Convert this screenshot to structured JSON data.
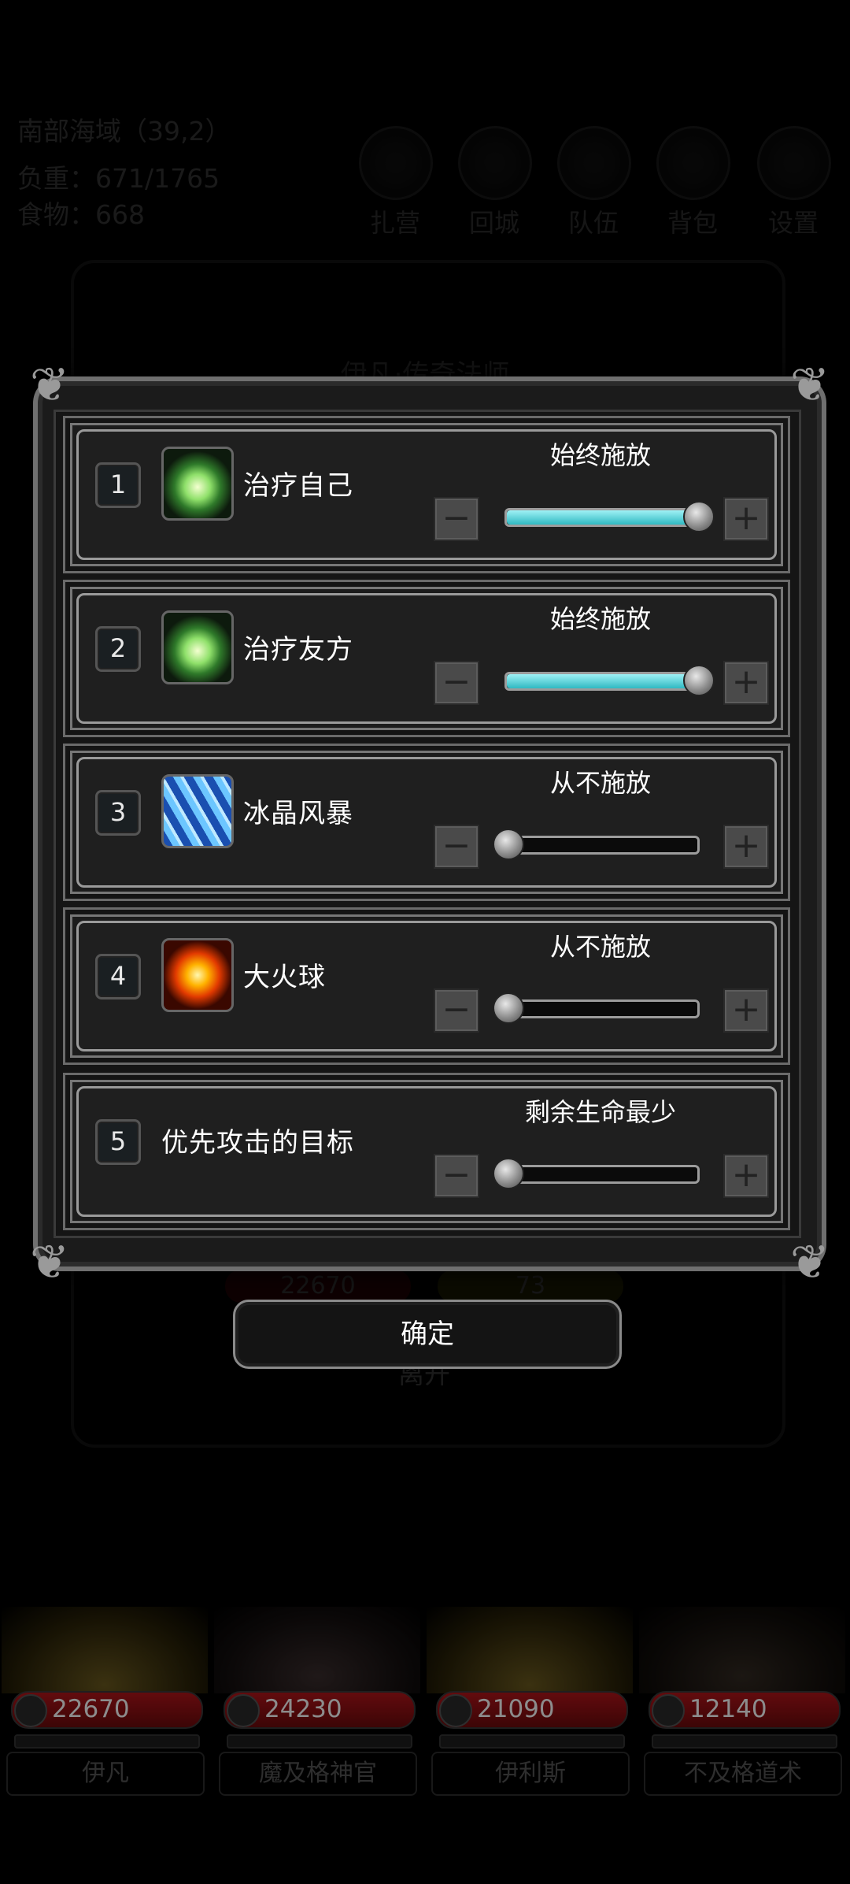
{
  "hud": {
    "location": "南部海域（39,2）",
    "load": "负重：671/1765",
    "food": "食物：668",
    "buttons": [
      {
        "label": "扎营",
        "icon": "camp-icon"
      },
      {
        "label": "回城",
        "icon": "return-city-icon"
      },
      {
        "label": "队伍",
        "icon": "team-icon"
      },
      {
        "label": "背包",
        "icon": "backpack-icon"
      },
      {
        "label": "设置",
        "icon": "settings-icon"
      }
    ]
  },
  "background_panel": {
    "title": "伊凡·传奇法师",
    "hp": "22670",
    "energy": "73",
    "leave": "离开"
  },
  "dialog": {
    "rows": [
      {
        "index": "1",
        "icon": "heal-icon",
        "name": "治疗自己",
        "mode": "始终施放",
        "level": 1.0
      },
      {
        "index": "2",
        "icon": "heal-icon",
        "name": "治疗友方",
        "mode": "始终施放",
        "level": 1.0
      },
      {
        "index": "3",
        "icon": "ice-storm-icon",
        "name": "冰晶风暴",
        "mode": "从不施放",
        "level": 0.0
      },
      {
        "index": "4",
        "icon": "fireball-icon",
        "name": "大火球",
        "mode": "从不施放",
        "level": 0.0
      },
      {
        "index": "5",
        "icon": "",
        "name": "优先攻击的目标",
        "mode": "剩余生命最少",
        "level": 0.0
      }
    ],
    "minus_label": "−",
    "plus_label": "+",
    "confirm": "确定"
  },
  "heroes": [
    {
      "name": "伊凡",
      "hp": "22670"
    },
    {
      "name": "魔及格神官",
      "hp": "24230"
    },
    {
      "name": "伊利斯",
      "hp": "21090"
    },
    {
      "name": "不及格道术",
      "hp": "12140"
    }
  ],
  "colors": {
    "slider_fill": "#2fb9c2",
    "hp_bar": "#b3151a"
  }
}
